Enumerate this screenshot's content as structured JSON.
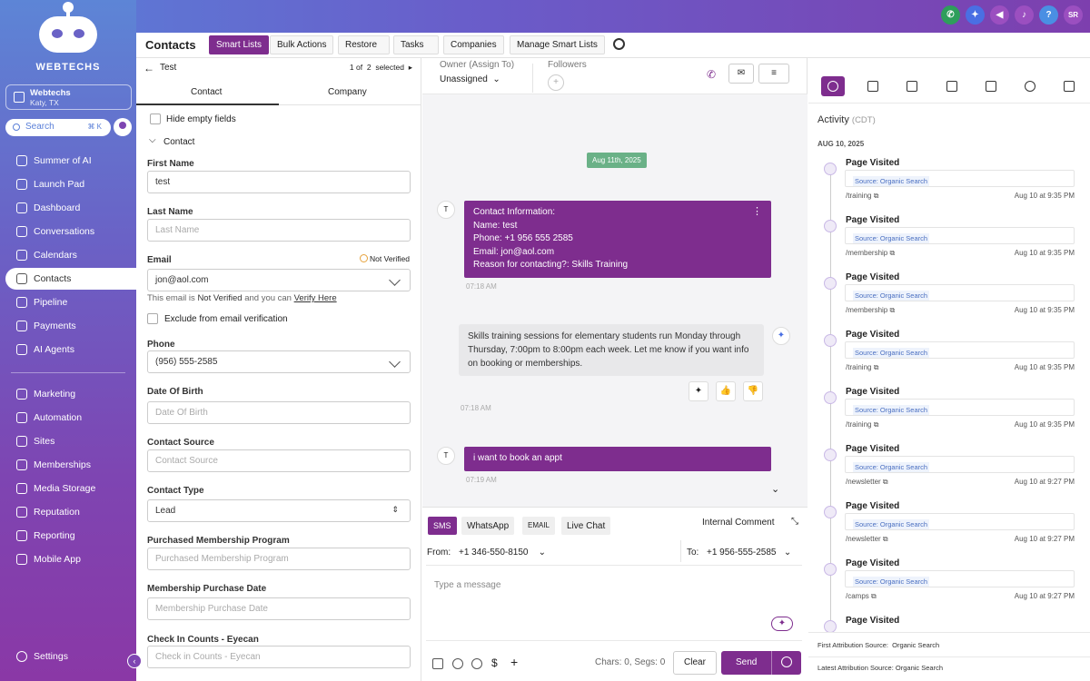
{
  "brand": {
    "name": "WEBTECHS"
  },
  "location": {
    "name": "Webtechs",
    "city": "Katy, TX"
  },
  "search": {
    "label": "Search",
    "shortcut": "⌘ K"
  },
  "sidebar": {
    "items": [
      {
        "label": "Summer of AI",
        "icon": "sparkle-icon"
      },
      {
        "label": "Launch Pad",
        "icon": "rocket-icon"
      },
      {
        "label": "Dashboard",
        "icon": "gauge-icon"
      },
      {
        "label": "Conversations",
        "icon": "chat-icon"
      },
      {
        "label": "Calendars",
        "icon": "calendar-icon"
      },
      {
        "label": "Contacts",
        "icon": "contact-card-icon"
      },
      {
        "label": "Pipeline",
        "icon": "funnel-icon"
      },
      {
        "label": "Payments",
        "icon": "dollar-icon"
      },
      {
        "label": "AI Agents",
        "icon": "sparkle-icon"
      },
      {
        "label": "Marketing",
        "icon": "megaphone-icon"
      },
      {
        "label": "Automation",
        "icon": "gear-icon"
      },
      {
        "label": "Sites",
        "icon": "globe-icon"
      },
      {
        "label": "Memberships",
        "icon": "badge-icon"
      },
      {
        "label": "Media Storage",
        "icon": "image-icon"
      },
      {
        "label": "Reputation",
        "icon": "star-icon"
      },
      {
        "label": "Reporting",
        "icon": "chart-icon"
      },
      {
        "label": "Mobile App",
        "icon": "phone-icon"
      },
      {
        "label": "Settings",
        "icon": "gear-icon"
      }
    ]
  },
  "topbar": {
    "user_initials": "SR",
    "colors": {
      "phone": "#2e9e5b",
      "accent": "#4a6fe3",
      "purple": "#7e2d8e"
    }
  },
  "subheader": {
    "title": "Contacts",
    "buttons": [
      "Smart Lists",
      "Bulk Actions",
      "Restore",
      "Tasks",
      "Companies",
      "Manage Smart Lists"
    ]
  },
  "contact": {
    "name": "Test",
    "pager": {
      "current": "1",
      "of": "of",
      "total": "2",
      "suffix": "selected"
    },
    "tabs": [
      "Contact",
      "Company"
    ],
    "hide_empty": "Hide empty fields",
    "section": "Contact",
    "fields": {
      "first_name": {
        "label": "First Name",
        "value": "test"
      },
      "last_name": {
        "label": "Last Name",
        "placeholder": "Last Name"
      },
      "email": {
        "label": "Email",
        "value": "jon@aol.com",
        "status": "Not Verified"
      },
      "email_hint_pre": "This email is",
      "email_hint_status": "Not Verified",
      "email_hint_mid": "and you can",
      "email_hint_link": "Verify Here",
      "exclude": "Exclude from email verification",
      "phone": {
        "label": "Phone",
        "value": "(956) 555-2585"
      },
      "dob": {
        "label": "Date Of Birth",
        "placeholder": "Date Of Birth"
      },
      "source": {
        "label": "Contact Source",
        "placeholder": "Contact Source"
      },
      "type": {
        "label": "Contact Type",
        "value": "Lead"
      },
      "program": {
        "label": "Purchased Membership Program",
        "placeholder": "Purchased Membership Program"
      },
      "purchase_date": {
        "label": "Membership Purchase Date",
        "placeholder": "Membership Purchase Date"
      },
      "checkin": {
        "label": "Check In Counts - Eyecan",
        "placeholder": "Check in Counts - Eyecan"
      }
    }
  },
  "conversation": {
    "owner_label": "Owner (Assign To)",
    "owner_value": "Unassigned",
    "followers_label": "Followers",
    "date_pill": "Aug 11th, 2025",
    "avatar": "T",
    "msg1": {
      "lines": [
        "Contact Information:",
        "Name: test",
        "Phone: +1 956 555 2585",
        "Email: jon@aol.com",
        "Reason for contacting?: Skills Training"
      ],
      "time": "07:18 AM"
    },
    "msg2": {
      "text": "Skills training sessions for elementary students run Monday through Thursday, 7:00pm to 8:00pm each week. Let me know if you want info on booking or memberships.",
      "time": "07:18 AM"
    },
    "msg3": {
      "text": "i want to book an appt",
      "time": "07:19 AM"
    },
    "composer": {
      "tabs": [
        "SMS",
        "WhatsApp",
        "EMAIL",
        "Live Chat"
      ],
      "internal": "Internal Comment",
      "from_label": "From:",
      "from_value": "+1 346-550-8150",
      "to_label": "To:",
      "to_value": "+1 956-555-2585",
      "placeholder": "Type a message",
      "chars": "Chars: 0, Segs: 0",
      "clear": "Clear",
      "send": "Send"
    }
  },
  "activity": {
    "title": "Activity",
    "tz": "(CDT)",
    "date": "AUG 10, 2025",
    "events": [
      {
        "title": "Page Visited",
        "source": "Source: Organic Search",
        "path": "/training",
        "time": "Aug 10 at 9:35 PM"
      },
      {
        "title": "Page Visited",
        "source": "Source: Organic Search",
        "path": "/membership",
        "time": "Aug 10 at 9:35 PM"
      },
      {
        "title": "Page Visited",
        "source": "Source: Organic Search",
        "path": "/membership",
        "time": "Aug 10 at 9:35 PM"
      },
      {
        "title": "Page Visited",
        "source": "Source: Organic Search",
        "path": "/training",
        "time": "Aug 10 at 9:35 PM"
      },
      {
        "title": "Page Visited",
        "source": "Source: Organic Search",
        "path": "/training",
        "time": "Aug 10 at 9:35 PM"
      },
      {
        "title": "Page Visited",
        "source": "Source: Organic Search",
        "path": "/newsletter",
        "time": "Aug 10 at 9:27 PM"
      },
      {
        "title": "Page Visited",
        "source": "Source: Organic Search",
        "path": "/newsletter",
        "time": "Aug 10 at 9:27 PM"
      },
      {
        "title": "Page Visited",
        "source": "Source: Organic Search",
        "path": "/camps",
        "time": "Aug 10 at 9:27 PM"
      },
      {
        "title": "Page Visited"
      }
    ],
    "first_attr": "First Attribution Source:",
    "first_attr_value": "Organic Search",
    "latest_attr": "Latest Attribution Source:",
    "latest_attr_value": "Organic Search"
  }
}
